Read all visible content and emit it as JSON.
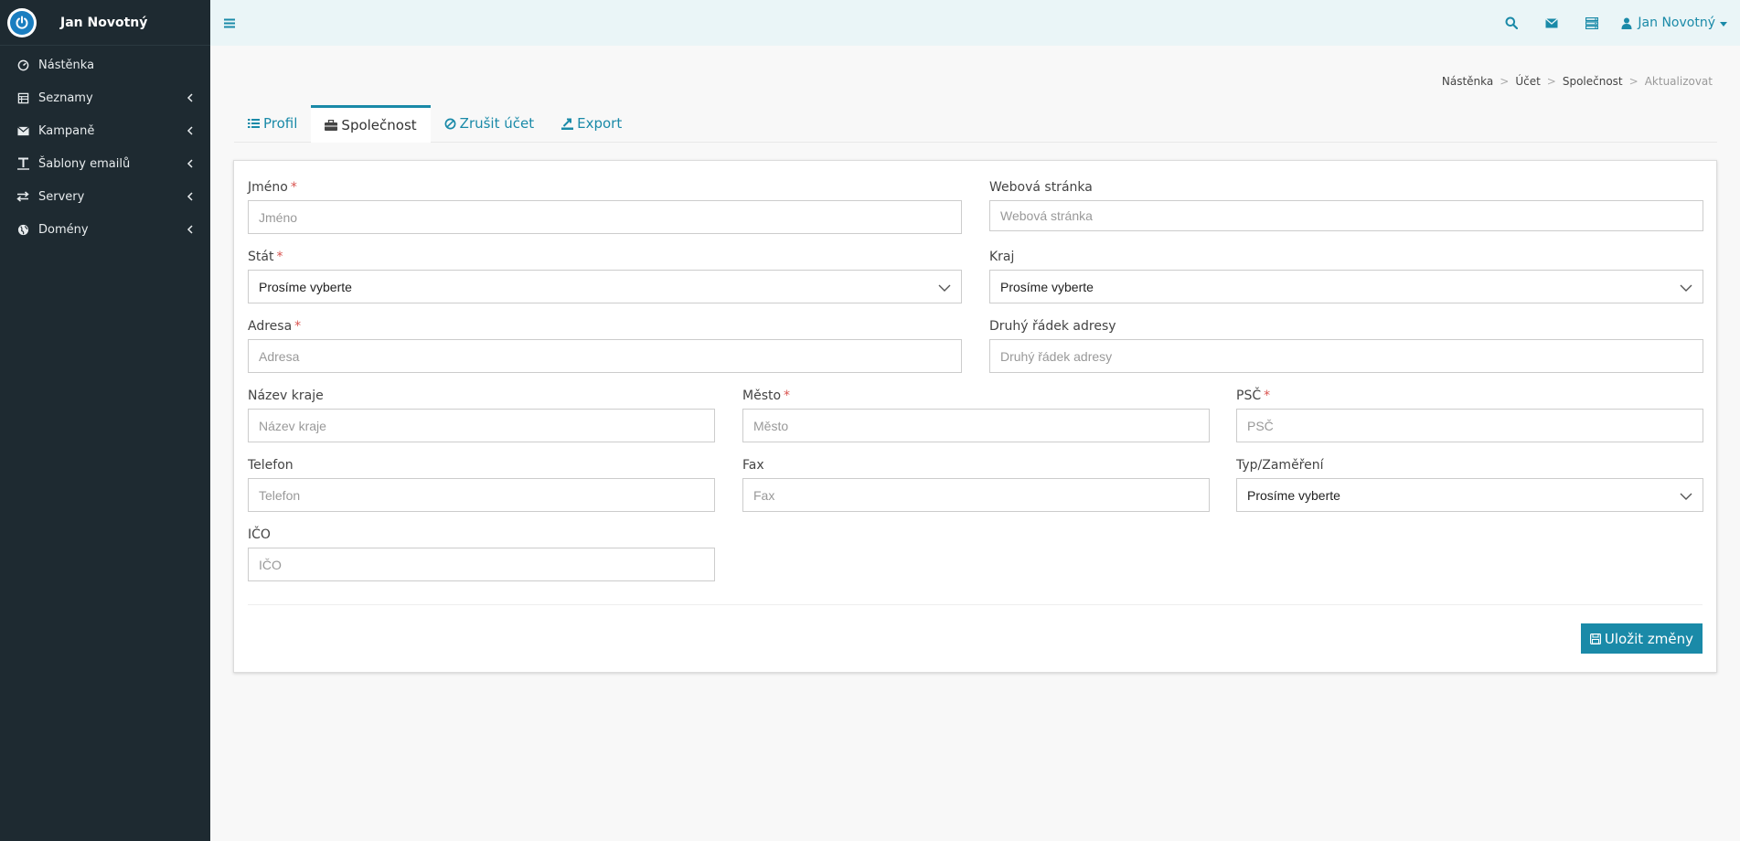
{
  "brand": {
    "name": "Jan Novotný",
    "logo_icon": "power-icon"
  },
  "sidebar": {
    "items": [
      {
        "label": "Nástěnka",
        "icon": "dashboard-icon",
        "has_submenu": false
      },
      {
        "label": "Seznamy",
        "icon": "list-icon",
        "has_submenu": true
      },
      {
        "label": "Kampaně",
        "icon": "envelope-icon",
        "has_submenu": true
      },
      {
        "label": "Šablony emailů",
        "icon": "text-icon",
        "has_submenu": true
      },
      {
        "label": "Servery",
        "icon": "exchange-icon",
        "has_submenu": true
      },
      {
        "label": "Domény",
        "icon": "globe-icon",
        "has_submenu": true
      }
    ]
  },
  "topbar": {
    "user_name": "Jan Novotný",
    "icons": [
      "search-icon",
      "envelope-icon",
      "server-icon"
    ]
  },
  "breadcrumb": {
    "items": [
      "Nástěnka",
      "Účet",
      "Společnost"
    ],
    "active": "Aktualizovat"
  },
  "tabs": [
    {
      "label": "Profil",
      "icon": "list-icon",
      "active": false
    },
    {
      "label": "Společnost",
      "icon": "briefcase-icon",
      "active": true
    },
    {
      "label": "Zrušit účet",
      "icon": "ban-icon",
      "active": false
    },
    {
      "label": "Export",
      "icon": "export-icon",
      "active": false
    }
  ],
  "form": {
    "name": {
      "label": "Jméno",
      "placeholder": "Jméno",
      "required": true
    },
    "website": {
      "label": "Webová stránka",
      "placeholder": "Webová stránka",
      "required": false
    },
    "country": {
      "label": "Stát",
      "value": "Prosíme vyberte",
      "required": true
    },
    "region": {
      "label": "Kraj",
      "value": "Prosíme vyberte",
      "required": false
    },
    "address": {
      "label": "Adresa",
      "placeholder": "Adresa",
      "required": true
    },
    "address2": {
      "label": "Druhý řádek adresy",
      "placeholder": "Druhý řádek adresy",
      "required": false
    },
    "region_name": {
      "label": "Název kraje",
      "placeholder": "Název kraje",
      "required": false
    },
    "city": {
      "label": "Město",
      "placeholder": "Město",
      "required": true
    },
    "zip": {
      "label": "PSČ",
      "placeholder": "PSČ",
      "required": true
    },
    "phone": {
      "label": "Telefon",
      "placeholder": "Telefon",
      "required": false
    },
    "fax": {
      "label": "Fax",
      "placeholder": "Fax",
      "required": false
    },
    "type": {
      "label": "Typ/Zaměření",
      "value": "Prosíme vyberte",
      "required": false
    },
    "ico": {
      "label": "IČO",
      "placeholder": "IČO",
      "required": false
    },
    "required_marker": "*"
  },
  "actions": {
    "save_label": "Uložit změny"
  },
  "colors": {
    "accent": "#1a8aa8",
    "sidebar_bg": "#1e2a31",
    "topbar_bg": "#eaf5f7",
    "required": "#d9534f"
  }
}
